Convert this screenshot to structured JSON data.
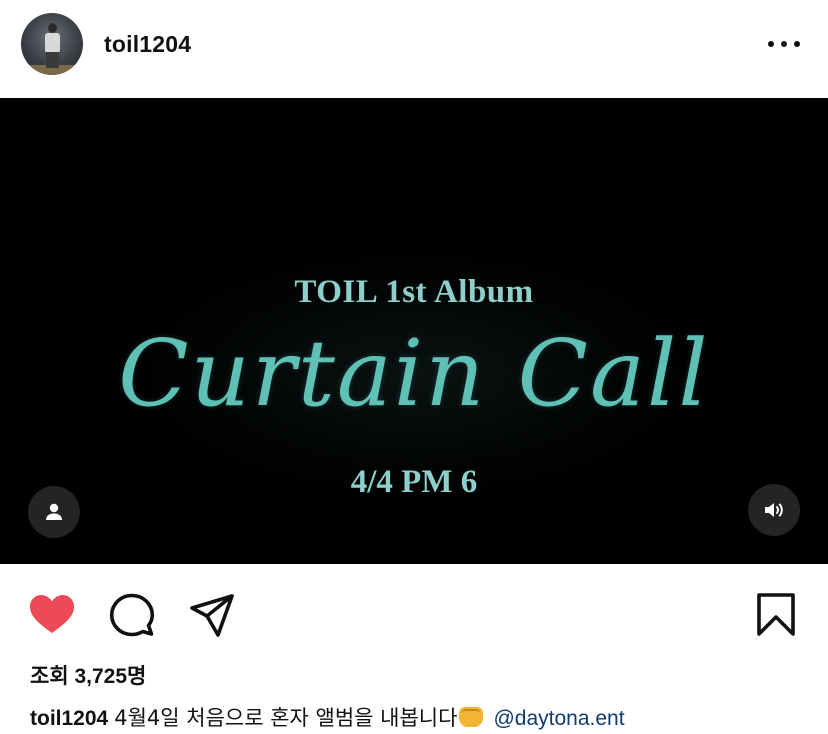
{
  "post": {
    "username": "toil1204",
    "avatar_icon": "profile-photo-avatar",
    "more_icon": "more-horizontal-icon"
  },
  "video": {
    "album_line": "TOIL 1st Album",
    "title_script": "Curtain Call",
    "date_line": "4/4 PM 6",
    "tag_icon": "person-tag-icon",
    "sound_icon": "speaker-volume-icon",
    "accent_color": "#5fc1b6"
  },
  "actions": {
    "like_icon": "heart-filled-icon",
    "like_color": "#ed4956",
    "comment_icon": "comment-bubble-icon",
    "share_icon": "paper-plane-icon",
    "save_icon": "bookmark-icon"
  },
  "stats": {
    "views": "조회 3,725명"
  },
  "caption": {
    "username": "toil1204",
    "text": "4월4일 처음으로 혼자 앨범을 내봅니다",
    "emoji_icon": "fist-emoji-icon",
    "mention": "@daytona.ent",
    "mention_color": "#0e3d6e"
  }
}
